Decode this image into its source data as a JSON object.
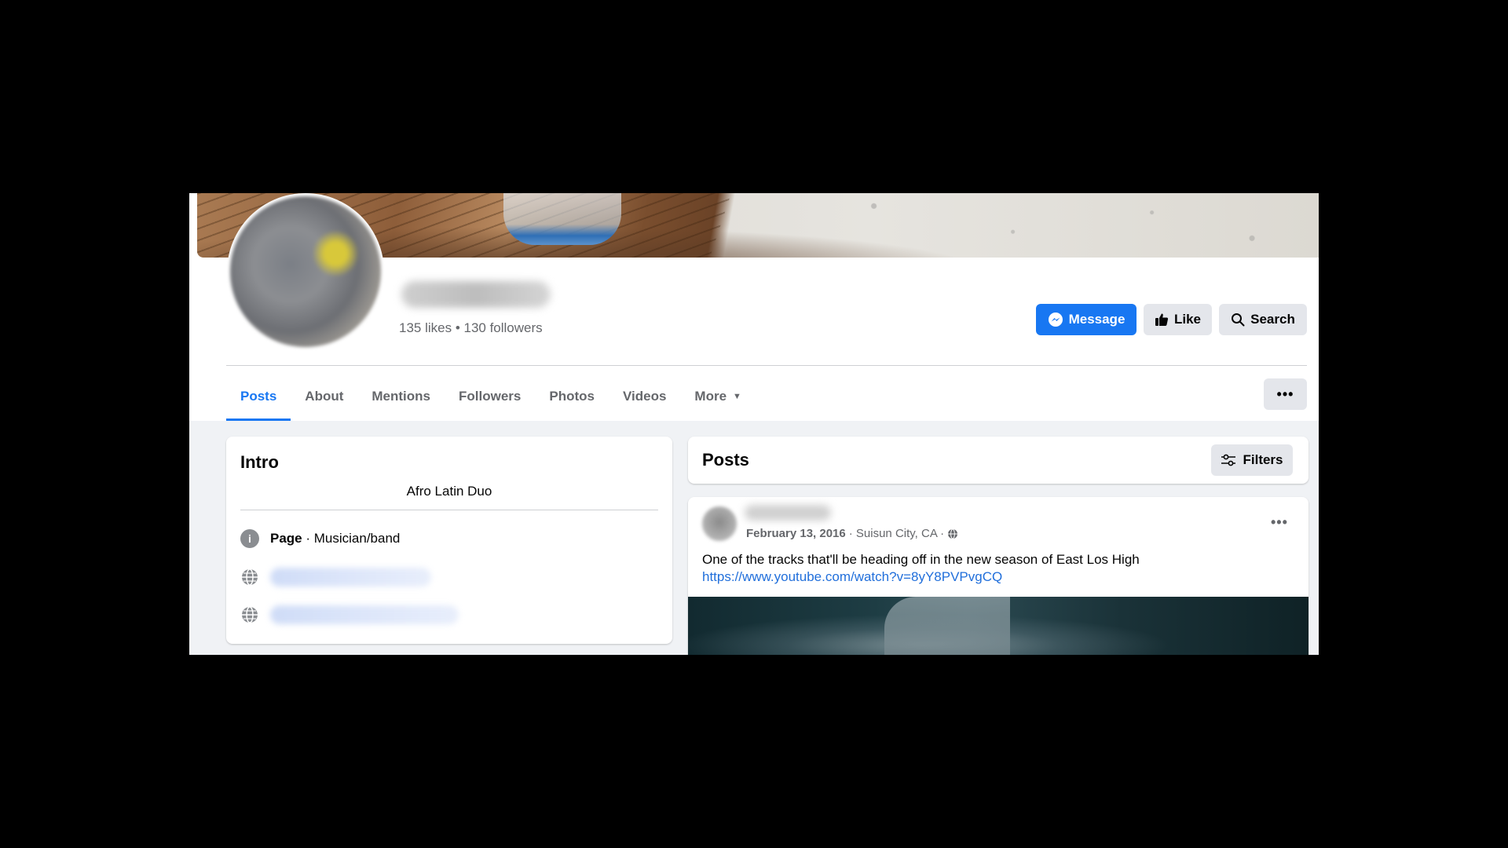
{
  "page": {
    "stats": "135 likes • 130 followers"
  },
  "actions": {
    "message": "Message",
    "like": "Like",
    "search": "Search",
    "more_dots": "•••"
  },
  "tabs": [
    {
      "label": "Posts",
      "active": true
    },
    {
      "label": "About"
    },
    {
      "label": "Mentions"
    },
    {
      "label": "Followers"
    },
    {
      "label": "Photos"
    },
    {
      "label": "Videos"
    },
    {
      "label": "More"
    }
  ],
  "intro": {
    "title": "Intro",
    "bio": "Afro Latin Duo",
    "page_label": "Page",
    "page_category": " · Musician/band"
  },
  "posts_section": {
    "title": "Posts",
    "filters_label": "Filters"
  },
  "post": {
    "date": "February 13, 2016",
    "location": "· Suisun City, CA ·",
    "text": "One of the tracks that'll be heading off in the new season of East Los High",
    "link": "https://www.youtube.com/watch?v=8yY8PVPvgCQ",
    "dots": "•••"
  },
  "colors": {
    "accent": "#1877f2",
    "secondary_button": "#e4e6eb",
    "muted_text": "#65676b",
    "link": "#216fdb"
  }
}
